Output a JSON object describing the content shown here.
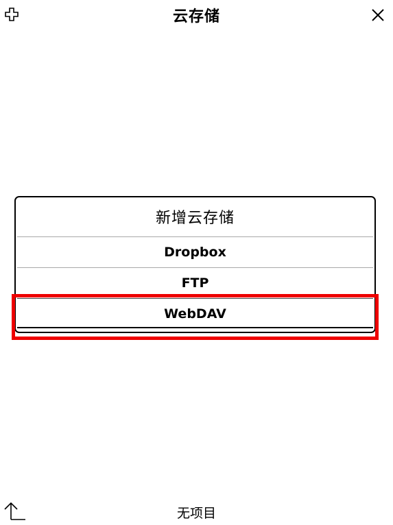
{
  "header": {
    "title": "云存储",
    "add_icon": "plus-outline-icon",
    "close_icon": "close-icon"
  },
  "dialog": {
    "title": "新增云存储",
    "options": [
      {
        "label": "Dropbox"
      },
      {
        "label": "FTP"
      },
      {
        "label": "WebDAV"
      }
    ],
    "selected_index": 2,
    "highlight_color": "#ee0000"
  },
  "footer": {
    "up_icon": "up-level-icon",
    "status": "无项目"
  }
}
